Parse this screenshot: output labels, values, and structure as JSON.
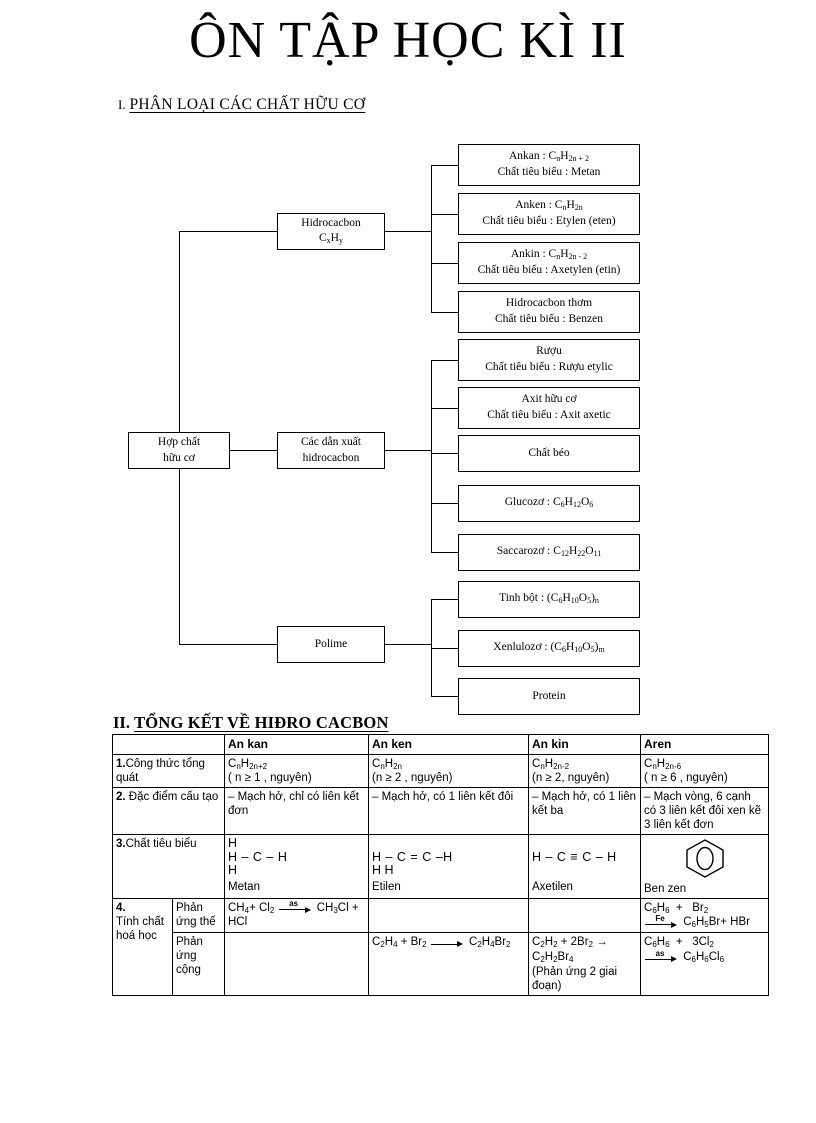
{
  "document": {
    "title": "ÔN TẬP HỌC KÌ II"
  },
  "section1": {
    "number": "I.",
    "heading": "PHÂN LOẠI CÁC CHẤT HỮU CƠ",
    "nodes": {
      "root": {
        "line1": "Hợp chất",
        "line2": "hữu cơ"
      },
      "hidrocacbon": {
        "line1": "Hidrocacbon",
        "line2": "CxHy"
      },
      "dan_xuat": {
        "line1": "Các dẫn xuất",
        "line2": "hidrocacbon"
      },
      "polime": {
        "line1": "Polime",
        "line2": ""
      }
    },
    "hidrocacbon_items": [
      {
        "line1": "Ankan : CnH2n + 2",
        "line2": "Chất tiêu biểu : Metan"
      },
      {
        "line1": "Anken : CnH2n",
        "line2": "Chất tiêu biểu : Etylen (eten)"
      },
      {
        "line1": "Ankin : CnH2n - 2",
        "line2": "Chất tiêu biểu : Axetylen (etin)"
      },
      {
        "line1": "Hidrocacbon thơm",
        "line2": "Chất tiêu biểu : Benzen"
      }
    ],
    "dan_xuat_items": [
      {
        "line1": "Rượu",
        "line2": "Chất tiêu biểu : Rượu etylic"
      },
      {
        "line1": "Axit hữu cơ",
        "line2": "Chất tiêu biểu : Axit axetic"
      },
      {
        "line1": "Chất béo",
        "line2": ""
      },
      {
        "line1": "Glucozơ : C6H12O6",
        "line2": ""
      },
      {
        "line1": "Saccarozơ : C12H22O11",
        "line2": ""
      }
    ],
    "polime_items": [
      {
        "line1": "Tinh bột : (C6H10O5)n",
        "line2": ""
      },
      {
        "line1": "Xenlulozơ : (C6H10O5)m",
        "line2": ""
      },
      {
        "line1": "Protein",
        "line2": ""
      }
    ]
  },
  "section2": {
    "number": "II.",
    "heading": "TỔNG KẾT VỀ HIĐRO CACBON",
    "columns": [
      "",
      "An kan",
      "An ken",
      "An kin",
      "Aren"
    ],
    "rows": {
      "cong_thuc": {
        "label_num": "1.",
        "label": "Công thức tổng quát",
        "ankan": {
          "formula": "CnH2n+2",
          "cond": "( n ≥ 1 , nguyên)"
        },
        "anken": {
          "formula": "CnH2n",
          "cond": "(n ≥ 2 , nguyên)"
        },
        "ankin": {
          "formula": "CnH2n-2",
          "cond": "(n ≥ 2, nguyên)"
        },
        "aren": {
          "formula": "CnH2n-6",
          "cond": "( n ≥ 6 , nguyên)"
        }
      },
      "dac_diem": {
        "label_num": "2.",
        "label": "Đặc điểm cấu tạo",
        "ankan": "– Mạch hở, chỉ có liên kết đơn",
        "anken": "– Mạch hở, có 1 liên kết đôi",
        "ankin": "– Mạch hở, có 1 liên kết ba",
        "aren": "– Mạch vòng, 6 cạnh có 3 liên kết đôi xen kẽ 3 liên kết đơn"
      },
      "chat_tieu_bieu": {
        "label_num": "3.",
        "label": "Chất tiêu biểu",
        "ankan_name": "Metan",
        "anken_name": "Etilen",
        "ankin_name": "Axetilen",
        "aren_name": "Ben zen",
        "metan": {
          "top": "H",
          "mid": "H – C – H",
          "bot": "H"
        },
        "etilen": {
          "mid": "H – C = C –H",
          "bot": "H    H"
        },
        "axetilen": {
          "mid": "H – C ≡ C – H"
        },
        "benzen_icon": "benzene-ring-icon"
      },
      "tinh_chat": {
        "label_num": "4.",
        "label": "Tính chất hoá học",
        "the_label": "Phản ứng thế",
        "cong_label": "Phản ứng cộng",
        "the": {
          "ankan": {
            "left": "CH4+ Cl2",
            "arrow": "as",
            "right": "CH3Cl + HCl"
          },
          "anken": "",
          "ankin": "",
          "aren": {
            "left": "C6H6  +   Br2",
            "arrow": "Fe",
            "right": "C6H5Br+ HBr"
          }
        },
        "cong": {
          "ankan": "",
          "anken": {
            "left": "C2H4 + Br2",
            "arrow": "",
            "right": "C2H4Br2"
          },
          "ankin": {
            "text": "C2H2 + 2Br2 → C2H2Br4",
            "note": "(Phản ứng 2 giai đoạn)"
          },
          "aren": {
            "left": "C6H6  +   3Cl2",
            "arrow": "as",
            "right": "C6H6Cl6"
          }
        }
      }
    }
  }
}
